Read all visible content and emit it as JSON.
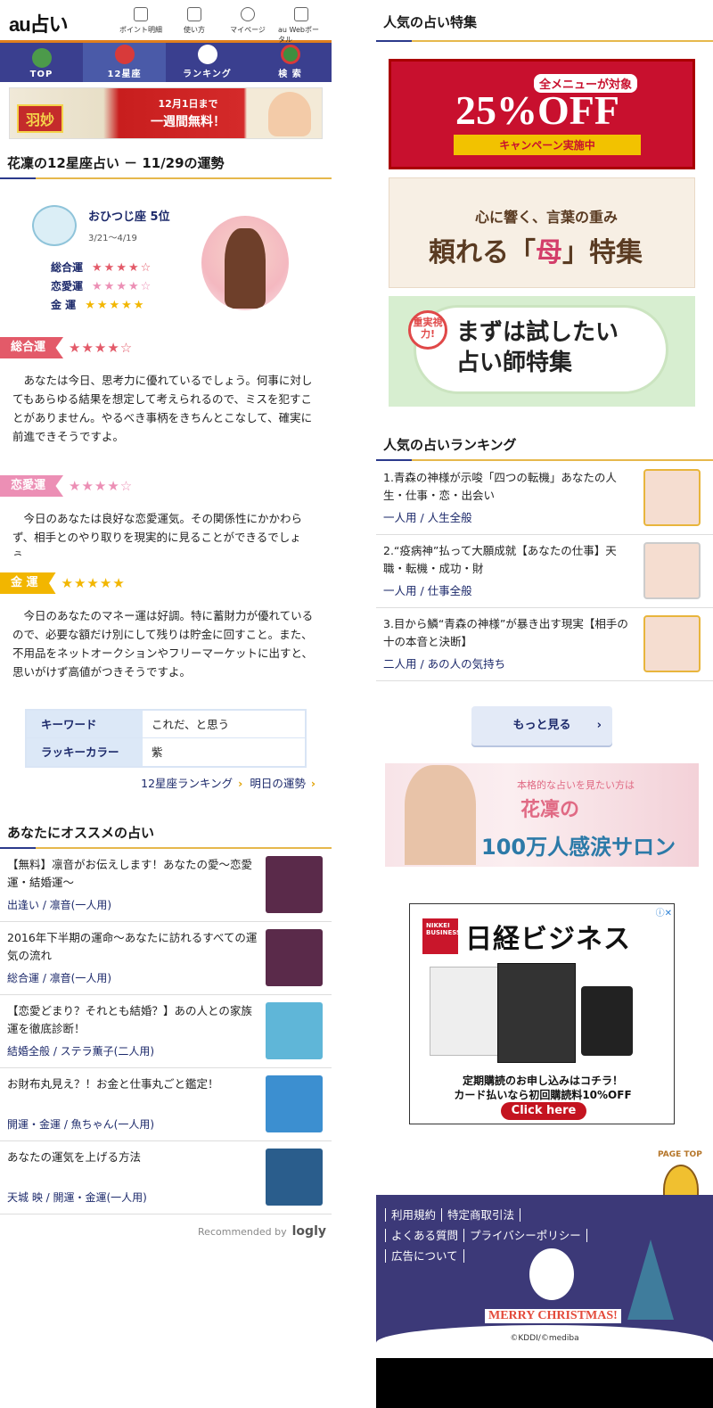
{
  "header": {
    "logo": "au占い",
    "nav": [
      {
        "label": "ポイント明細",
        "icon": "list-icon"
      },
      {
        "label": "使い方",
        "icon": "book-icon"
      },
      {
        "label": "マイページ",
        "icon": "user-icon"
      },
      {
        "label": "au Webポータル",
        "icon": "home-icon"
      }
    ]
  },
  "global_nav": [
    {
      "label": "TOP",
      "active": false
    },
    {
      "label": "12星座",
      "active": true
    },
    {
      "label": "ランキング",
      "active": false
    },
    {
      "label": "検 索",
      "active": false
    }
  ],
  "banner_top": {
    "tag": "羽妙",
    "line1": "12月1日まで",
    "line2": "一週間無料！"
  },
  "horoscope": {
    "title": "花凜の12星座占い － 11/29の運勢",
    "sign_rank": "おひつじ座 5位",
    "date_range": "3/21〜4/19",
    "ratings": [
      {
        "label": "総合運",
        "stars": "★★★★☆",
        "value": 4
      },
      {
        "label": "恋愛運",
        "stars": "★★★★☆",
        "value": 4
      },
      {
        "label": "金 運",
        "stars": "★★★★★",
        "value": 5
      }
    ],
    "sections": [
      {
        "label": "総合運",
        "stars": "★★★★☆",
        "text": "あなたは今日、思考力に優れているでしょう。何事に対してもあらゆる結果を想定して考えられるので、ミスを犯すことがありません。やるべき事柄をきちんとこなして、確実に前進できそうですよ。"
      },
      {
        "label": "恋愛運",
        "stars": "★★★★☆",
        "text": "今日のあなたは良好な恋愛運気。その関係性にかかわらず、相手とのやり取りを現実的に見ることができるでしょう。"
      },
      {
        "label": "金 運",
        "stars": "★★★★★",
        "text": "今日のあなたのマネー運は好調。特に蓄財力が優れているので、必要な額だけ別にして残りは貯金に回すこと。また、不用品をネットオークションやフリーマーケットに出すと、思いがけず高値がつきそうですよ。"
      }
    ],
    "keyword_label": "キーワード",
    "keyword": "これだ、と思う",
    "lucky_color_label": "ラッキーカラー",
    "lucky_color": "紫",
    "link_ranking": "12星座ランキング",
    "link_tomorrow": "明日の運勢"
  },
  "recommend": {
    "title": "あなたにオススメの占い",
    "items": [
      {
        "title": "【無料】凛音がお伝えします！あなたの愛〜恋愛運・結婚運〜",
        "meta": "出逢い / 凛音(一人用)"
      },
      {
        "title": "2016年下半期の運命〜あなたに訪れるすべての運気の流れ",
        "meta": "総合運 / 凛音(一人用)"
      },
      {
        "title": "【恋愛どまり？それとも結婚？】あの人との家族運を徹底診断！",
        "meta": "結婚全般 / ステラ薫子(二人用)"
      },
      {
        "title": "お財布丸見え？！お金と仕事丸ごと鑑定！",
        "meta": "開運・金運 / 魚ちゃん(一人用)"
      },
      {
        "title": "あなたの運気を上げる方法",
        "meta": "天城 映 / 開運・金運(一人用)"
      }
    ],
    "credit": "Recommended by",
    "credit_brand": "logly"
  },
  "right": {
    "popular_title": "人気の占い特集",
    "banner_sale": {
      "top": "全メニューが対象",
      "main": "25%OFF",
      "sub": "キャンペーン実施中"
    },
    "banner_mother": {
      "line1": "心に響く、言葉の重み",
      "line2a": "頼れる「",
      "line2b": "母",
      "line2c": "」特集"
    },
    "banner_try": {
      "circle": "重実視力!",
      "line1": "まずは試したい",
      "line2": "占い師特集"
    },
    "ranking_title": "人気の占いランキング",
    "ranking": [
      {
        "title": "1.青森の神様が示唆「四つの転機」あなたの人生・仕事・恋・出会い",
        "meta": "一人用 / 人生全般"
      },
      {
        "title": "2.“疫病神”払って大願成就【あなたの仕事】天職・転機・成功・財",
        "meta": "一人用 / 仕事全般"
      },
      {
        "title": "3.目から鱗“青森の神様”が暴き出す現実【相手の十の本音と決断】",
        "meta": "二人用 / あの人の気持ち"
      }
    ],
    "more": "もっと見る",
    "salon": {
      "line1": "本格的な占いを見たい方は",
      "line2": "花凜の",
      "line3": "100万人感涙サロン"
    },
    "ad": {
      "brand": "日経ビジネス",
      "line1": "定期購読のお申し込みはコチラ！",
      "line2": "カード払いなら初回購読料10%OFF",
      "cta": "Click here"
    },
    "pagetop": "PAGE TOP",
    "footer_links": [
      "利用規約",
      "特定商取引法",
      "よくある質問",
      "プライバシーポリシー",
      "広告について"
    ],
    "xmas": "MERRY CHRISTMAS!",
    "copyright": "©KDDI/©mediba"
  },
  "colors": {
    "accent_orange": "#e07f1d",
    "nav_blue": "#3a3f8f",
    "gold_line": "#e6b84c",
    "red_tag": "#e35a69",
    "pink_tag": "#ec8fb5",
    "gold_tag": "#f2b600"
  }
}
